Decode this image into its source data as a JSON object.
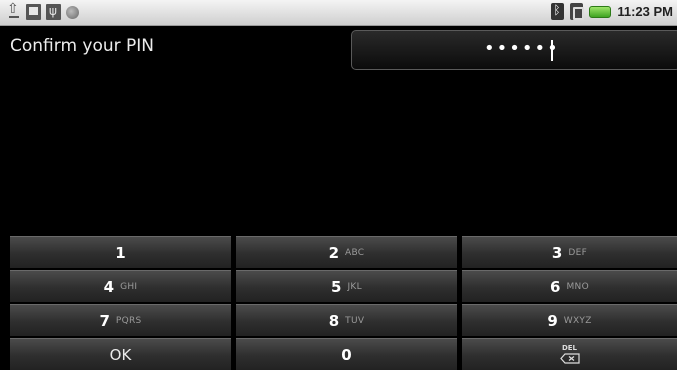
{
  "status_bar": {
    "time": "11:23 PM",
    "left_icons": [
      "upload-icon",
      "storage-icon",
      "usb-debug-icon",
      "sync-icon"
    ],
    "right_icons": [
      "bluetooth-icon",
      "signal-icon",
      "battery-icon"
    ],
    "battery_color": "#4fbf2a"
  },
  "pin": {
    "label": "Confirm your PIN",
    "masked_value": "••••••"
  },
  "keypad": {
    "keys": [
      {
        "num": "1",
        "sub": ""
      },
      {
        "num": "2",
        "sub": "ABC"
      },
      {
        "num": "3",
        "sub": "DEF"
      },
      {
        "num": "4",
        "sub": "GHI"
      },
      {
        "num": "5",
        "sub": "JKL"
      },
      {
        "num": "6",
        "sub": "MNO"
      },
      {
        "num": "7",
        "sub": "PQRS"
      },
      {
        "num": "8",
        "sub": "TUV"
      },
      {
        "num": "9",
        "sub": "WXYZ"
      }
    ],
    "ok_label": "OK",
    "zero_label": "0",
    "delete_label": "DEL"
  }
}
